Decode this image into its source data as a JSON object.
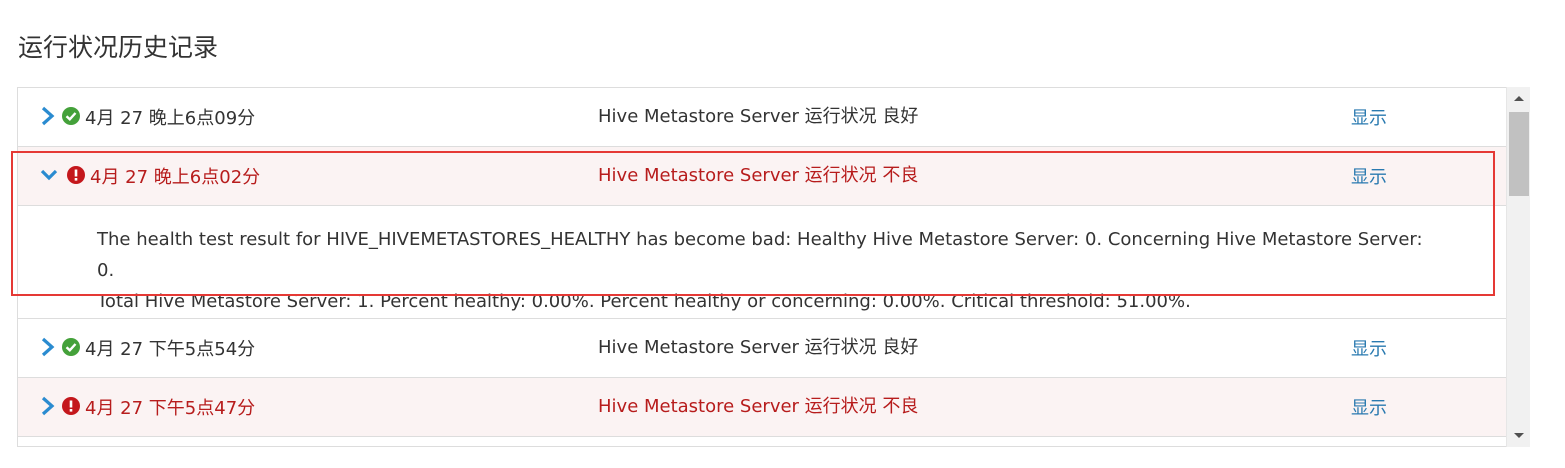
{
  "page": {
    "title": "运行状况历史记录"
  },
  "rows": [
    {
      "time": "4月 27 晚上6点09分",
      "message": "Hive Metastore Server 运行状况 良好",
      "status": "good",
      "show_label": "显示",
      "expanded": false
    },
    {
      "time": "4月 27 晚上6点02分",
      "message": "Hive Metastore Server 运行状况 不良",
      "status": "bad",
      "show_label": "显示",
      "expanded": true,
      "detail_line1": "The health test result for HIVE_HIVEMETASTORES_HEALTHY has become bad: Healthy Hive Metastore Server: 0. Concerning Hive Metastore Server: 0.",
      "detail_line2": "Total Hive Metastore Server: 1. Percent healthy: 0.00%. Percent healthy or concerning: 0.00%. Critical threshold: 51.00%."
    },
    {
      "time": "4月 27 下午5点54分",
      "message": "Hive Metastore Server 运行状况 良好",
      "status": "good",
      "show_label": "显示",
      "expanded": false
    },
    {
      "time": "4月 27 下午5点47分",
      "message": "Hive Metastore Server 运行状况 不良",
      "status": "bad",
      "show_label": "显示",
      "expanded": false
    }
  ],
  "colors": {
    "good": "#44a13a",
    "bad": "#c4171c",
    "link": "#2a7ab0",
    "highlight": "#e53935"
  },
  "icons": {
    "collapsed": "chevron-right-icon",
    "expanded": "chevron-down-icon",
    "good": "check-circle-icon",
    "bad": "exclamation-circle-icon"
  }
}
